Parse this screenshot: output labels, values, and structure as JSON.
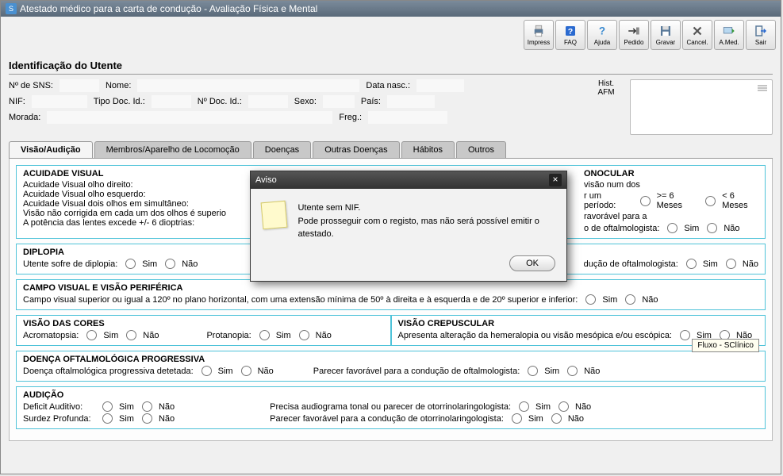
{
  "window": {
    "title": "Atestado médico para a carta de condução - Avaliação Física e Mental"
  },
  "toolbar": {
    "impress": "Impress",
    "faq": "FAQ",
    "ajuda": "Ajuda",
    "pedido": "Pedido",
    "gravar": "Gravar",
    "cancel": "Cancel.",
    "amed": "A.Med.",
    "sair": "Sair"
  },
  "ident": {
    "title": "Identificação do Utente",
    "sns": "Nº de SNS:",
    "nome": "Nome:",
    "datanasc": "Data nasc.:",
    "nif": "NIF:",
    "tipodoc": "Tipo Doc. Id.:",
    "ndoc": "Nº Doc. Id.:",
    "sexo": "Sexo:",
    "pais": "País:",
    "morada": "Morada:",
    "freg": "Freg.:",
    "hist": "Hist.",
    "afm": "AFM"
  },
  "tabs": {
    "t0": "Visão/Audição",
    "t1": "Membros/Aparelho de Locomoção",
    "t2": "Doenças",
    "t3": "Outras Doenças",
    "t4": "Hábitos",
    "t5": "Outros"
  },
  "labels": {
    "sim": "Sim",
    "nao": "Não",
    "ge6": ">= 6 Meses",
    "lt6": "< 6 Meses"
  },
  "acuity": {
    "title": "ACUIDADE VISUAL",
    "r1": "Acuidade Visual olho direito:",
    "r2": "Acuidade Visual olho esquerdo:",
    "r3": "Acuidade Visual dois olhos em simultâneo:",
    "r4": "Visão não corrigida em cada um dos olhos é superio",
    "r5": "A potência das lentes excede +/- 6 dioptrias:"
  },
  "mono": {
    "title": "ONOCULAR",
    "l1": "visão num dos",
    "l2": "r um período:",
    "l3": "ravorável para a",
    "l4": "o de oftalmologista:"
  },
  "diplopia": {
    "title": "DIPLOPIA",
    "l1": "Utente sofre de diplopia:",
    "l2": "dução de oftalmologista:"
  },
  "campo": {
    "title": "CAMPO VISUAL E VISÃO PERIFÉRICA",
    "l1": "Campo visual superior ou igual a 120º no plano horizontal, com uma extensão mínima de 50º à direita e à esquerda e de 20º superior e inferior:"
  },
  "cores": {
    "title": "VISÃO DAS CORES",
    "acro": "Acromatopsia:",
    "prot": "Protanopia:"
  },
  "crep": {
    "title": "VISÃO CREPUSCULAR",
    "l1": "Apresenta alteração da hemeralopia ou visão mesópica e/ou escópica:"
  },
  "doprog": {
    "title": "DOENÇA OFTALMOLÓGICA PROGRESSIVA",
    "l1": "Doença oftalmológica progressiva detetada:",
    "l2": "Parecer favorável para a condução de oftalmologista:"
  },
  "audicao": {
    "title": "AUDIÇÃO",
    "l1": "Deficit Auditivo:",
    "l2": "Surdez Profunda:",
    "l3": "Precisa audiograma tonal ou parecer de otorrinolaringologista:",
    "l4": "Parecer favorável para a condução de otorrinolaringologista:"
  },
  "modal": {
    "title": "Aviso",
    "line1": "Utente sem NIF.",
    "line2": "Pode prosseguir com o registo, mas não será possível emitir o atestado.",
    "ok": "OK"
  },
  "tooltip": "Fluxo - SClínico"
}
